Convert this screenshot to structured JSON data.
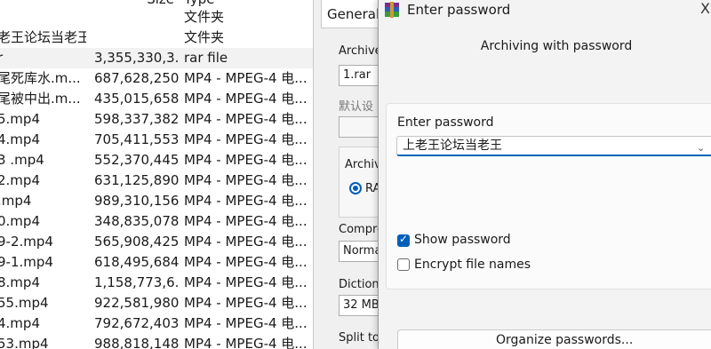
{
  "file_list": {
    "header_partial": {
      "size": "Size",
      "type": "Type"
    },
    "rows": [
      {
        "name": "",
        "size": "",
        "type": "文件夹"
      },
      {
        "name": "老王论坛当老王",
        "size": "",
        "type": "文件夹"
      },
      {
        "name": "r",
        "size": "3,355,330,3...",
        "type": "rar file"
      },
      {
        "name": "尾死库水.m...",
        "size": "687,628,250",
        "type": "MP4 - MPEG-4 电..."
      },
      {
        "name": "尾被中出.m...",
        "size": "435,015,658",
        "type": "MP4 - MPEG-4 电..."
      },
      {
        "name": "5.mp4",
        "size": "598,337,382",
        "type": "MP4 - MPEG-4 电..."
      },
      {
        "name": "4.mp4",
        "size": "705,411,553",
        "type": "MP4 - MPEG-4 电..."
      },
      {
        "name": "3 .mp4",
        "size": "552,370,445",
        "type": "MP4 - MPEG-4 电..."
      },
      {
        "name": "2.mp4",
        "size": "631,125,890",
        "type": "MP4 - MPEG-4 电..."
      },
      {
        "name": ".mp4",
        "size": "989,310,156",
        "type": "MP4 - MPEG-4 电..."
      },
      {
        "name": "0.mp4",
        "size": "348,835,078",
        "type": "MP4 - MPEG-4 电..."
      },
      {
        "name": "9-2.mp4",
        "size": "565,908,425",
        "type": "MP4 - MPEG-4 电..."
      },
      {
        "name": "9-1.mp4",
        "size": "618,495,684",
        "type": "MP4 - MPEG-4 电..."
      },
      {
        "name": "8.mp4",
        "size": "1,158,773,6...",
        "type": "MP4 - MPEG-4 电..."
      },
      {
        "name": "55.mp4",
        "size": "922,581,980",
        "type": "MP4 - MPEG-4 电..."
      },
      {
        "name": "4.mp4",
        "size": "792,672,403",
        "type": "MP4 - MPEG-4 电..."
      },
      {
        "name": "53.mp4",
        "size": "988,818,148",
        "type": "MP4 - MPEG-4 电..."
      }
    ]
  },
  "settings_dialog": {
    "tab_general": "General",
    "archive_name_label": "Archive",
    "archive_name_value": "1.rar",
    "default_profile_label": "默认设",
    "archive_format_label": "Archiv",
    "format_rar_label": "RA",
    "compression_label": "Compre",
    "compression_value": "Norma",
    "dictionary_label": "Dictiona",
    "dictionary_value": "32 MB",
    "split_label": "Split to"
  },
  "password_dialog": {
    "title": "Enter password",
    "subtitle": "Archiving with password",
    "enter_password_label": "Enter password",
    "password_value": "上老王论坛当老王",
    "show_password_label": "Show password",
    "show_password_checked": true,
    "encrypt_names_label": "Encrypt file names",
    "encrypt_names_checked": false,
    "organize_button": "Organize passwords...",
    "close_glyph": "X"
  },
  "colors": {
    "accent": "#005fb8",
    "dialog_bg": "#f3f3f3",
    "panel_bg": "#fbfbfb"
  }
}
